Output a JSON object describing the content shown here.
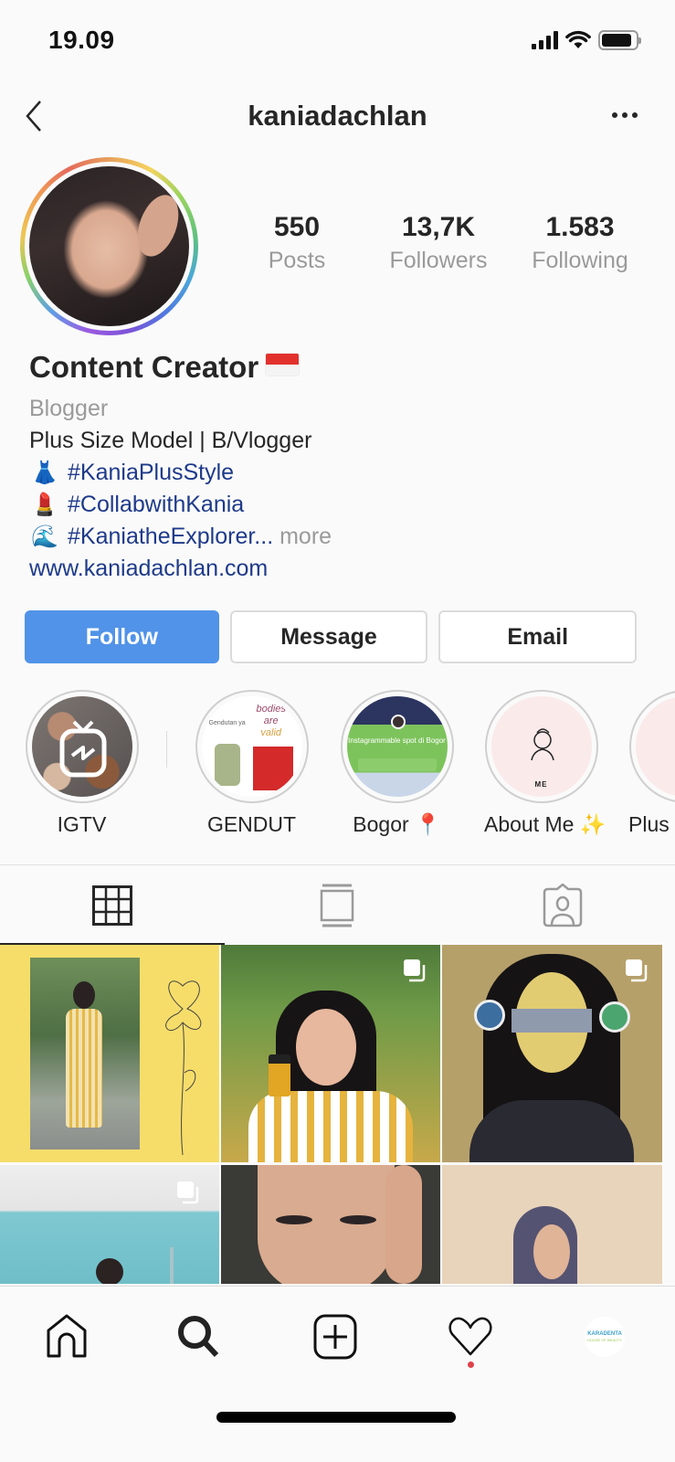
{
  "status_bar": {
    "time": "19.09",
    "icons": [
      "cellular-signal-icon",
      "wifi-icon",
      "battery-icon"
    ],
    "battery_level": 0.85
  },
  "header": {
    "username": "kaniadachlan",
    "back_icon": "chevron-left-icon",
    "more_icon": "ellipsis-icon"
  },
  "profile": {
    "stats": [
      {
        "value": "550",
        "label": "Posts"
      },
      {
        "value": "13,7K",
        "label": "Followers"
      },
      {
        "value": "1.583",
        "label": "Following"
      }
    ],
    "name": "Content Creator",
    "name_emoji": "indonesia-flag",
    "category": "Blogger",
    "bio_line": "Plus Size Model | B/Vlogger",
    "hashtags": [
      {
        "emoji": "👗",
        "tag": "#KaniaPlusStyle"
      },
      {
        "emoji": "💄",
        "tag": "#CollabwithKania"
      },
      {
        "emoji": "🌊",
        "tag": "#KaniatheExplorer..."
      }
    ],
    "more_label": "more",
    "website": "www.kaniadachlan.com"
  },
  "actions": {
    "follow": "Follow",
    "message": "Message",
    "email": "Email"
  },
  "colors": {
    "follow_button": "#5193e8",
    "hashtag": "#1e3a8a",
    "secondary_text": "#9a9a9a",
    "notification_dot": "#e0414b"
  },
  "highlights": [
    {
      "label": "IGTV"
    },
    {
      "label": "GENDUT"
    },
    {
      "label": "Bogor 📍"
    },
    {
      "label": "About Me ✨"
    },
    {
      "label": "Plus"
    }
  ],
  "highlight_content": {
    "bogor_text": "Instagrammable spot di Bogor",
    "about_text": "ME"
  },
  "tabs": [
    {
      "name": "grid",
      "icon": "grid-icon",
      "active": true
    },
    {
      "name": "igtv",
      "icon": "igtv-feed-icon",
      "active": false
    },
    {
      "name": "tagged",
      "icon": "tagged-person-icon",
      "active": false
    }
  ],
  "posts": [
    {
      "desc": "yellow striped outfit collage",
      "multi": false
    },
    {
      "desc": "holding product jar",
      "multi": true
    },
    {
      "desc": "face mask review",
      "multi": true
    },
    {
      "desc": "blue room",
      "multi": true
    },
    {
      "desc": "makeup close-up",
      "multi": false
    },
    {
      "desc": "hijab portrait",
      "multi": false
    }
  ],
  "bottom_nav": [
    {
      "name": "home",
      "icon": "home-icon"
    },
    {
      "name": "search",
      "icon": "search-icon"
    },
    {
      "name": "new-post",
      "icon": "add-post-icon"
    },
    {
      "name": "activity",
      "icon": "heart-icon"
    },
    {
      "name": "profile",
      "icon": "profile-avatar"
    }
  ],
  "nav_avatar": {
    "line1": "KARADENTA",
    "line2": "HOUSE OF BEAUTY"
  }
}
